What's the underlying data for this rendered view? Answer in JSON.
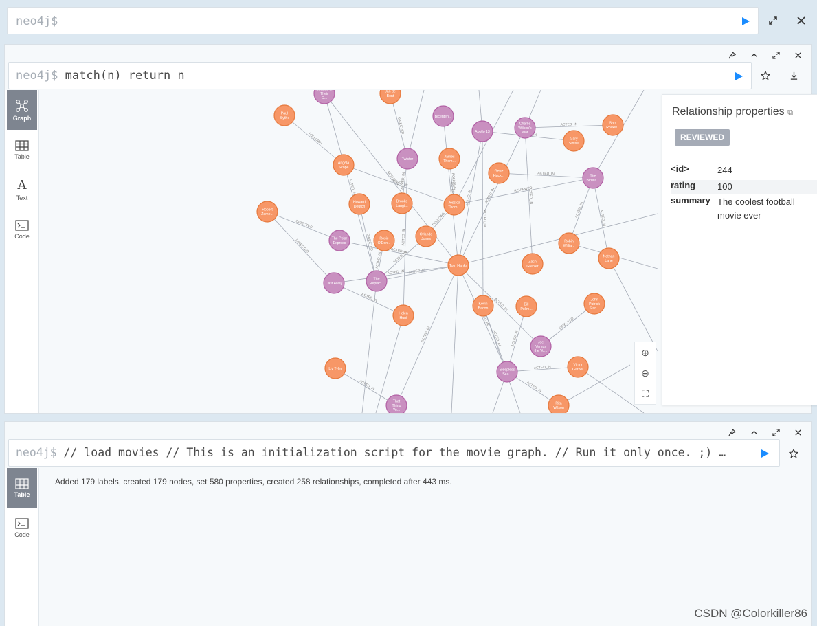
{
  "top_editor": {
    "prompt": "neo4j$"
  },
  "frame1": {
    "prompt": "neo4j$",
    "query": "match(n) return n",
    "tabs": [
      {
        "label": "Graph",
        "icon": "graph-icon"
      },
      {
        "label": "Table",
        "icon": "table-icon"
      },
      {
        "label": "Text",
        "icon": "text-icon"
      },
      {
        "label": "Code",
        "icon": "code-icon"
      }
    ],
    "panel": {
      "title": "Relationship properties",
      "badge": "REVIEWED",
      "rows": [
        {
          "key": "<id>",
          "value": "244"
        },
        {
          "key": "rating",
          "value": "100"
        },
        {
          "key": "summary",
          "value": "The coolest football movie ever"
        }
      ]
    }
  },
  "graph": {
    "colors": {
      "person": "#f79767",
      "person_stroke": "#e6793d",
      "movie": "#c990c0",
      "movie_stroke": "#b261a5",
      "edge": "#a5abb6"
    },
    "nodes": [
      {
        "id": "lt",
        "label": "League of Their O...",
        "kind": "movie"
      },
      {
        "id": "jb",
        "label": "Jan de Bont",
        "kind": "person"
      },
      {
        "id": "ps",
        "label": "Paul Blythe",
        "kind": "person"
      },
      {
        "id": "bc",
        "label": "Bicenten...",
        "kind": "movie"
      },
      {
        "id": "ap",
        "label": "Apollo 13",
        "kind": "movie"
      },
      {
        "id": "cw",
        "label": "Charlie Wilson's War",
        "kind": "movie"
      },
      {
        "id": "sr",
        "label": "Sam Rockw...",
        "kind": "person"
      },
      {
        "id": "gs",
        "label": "Gary Sinise",
        "kind": "person"
      },
      {
        "id": "as",
        "label": "Angela Scope",
        "kind": "person"
      },
      {
        "id": "tw",
        "label": "Twister",
        "kind": "movie"
      },
      {
        "id": "jt",
        "label": "James Thom...",
        "kind": "person"
      },
      {
        "id": "gh",
        "label": "Gene Hack...",
        "kind": "person"
      },
      {
        "id": "tb",
        "label": "The Birdca...",
        "kind": "movie"
      },
      {
        "id": "hd",
        "label": "Howard Deutch",
        "kind": "person"
      },
      {
        "id": "bl",
        "label": "Brooke Langt...",
        "kind": "person"
      },
      {
        "id": "jh",
        "label": "Jessica Thom...",
        "kind": "person"
      },
      {
        "id": "rz",
        "label": "Robert Zeme...",
        "kind": "person"
      },
      {
        "id": "pe",
        "label": "The Polar Express",
        "kind": "movie"
      },
      {
        "id": "ro",
        "label": "Rosie O'Don...",
        "kind": "person"
      },
      {
        "id": "oj",
        "label": "Orlando Jones",
        "kind": "person"
      },
      {
        "id": "rw",
        "label": "Robin Willia...",
        "kind": "person"
      },
      {
        "id": "nl",
        "label": "Nathan Lane",
        "kind": "person"
      },
      {
        "id": "th",
        "label": "Tom Hanks",
        "kind": "person"
      },
      {
        "id": "zg",
        "label": "Zach Grenier",
        "kind": "person"
      },
      {
        "id": "ca",
        "label": "Cast Away",
        "kind": "movie"
      },
      {
        "id": "tr",
        "label": "The Replac...",
        "kind": "movie"
      },
      {
        "id": "kb",
        "label": "Kevin Bacon",
        "kind": "person"
      },
      {
        "id": "bp",
        "label": "Bill Pullm...",
        "kind": "person"
      },
      {
        "id": "jp",
        "label": "John Patrick Stan...",
        "kind": "person"
      },
      {
        "id": "hh",
        "label": "Helen Hunt",
        "kind": "person"
      },
      {
        "id": "jv",
        "label": "Joe Versus the Vo...",
        "kind": "movie"
      },
      {
        "id": "ly",
        "label": "Liv Tyler",
        "kind": "person"
      },
      {
        "id": "vg",
        "label": "Victor Garber",
        "kind": "person"
      },
      {
        "id": "ss",
        "label": "Sleepless Sea...",
        "kind": "movie"
      },
      {
        "id": "tt",
        "label": "That Thing Yo...",
        "kind": "movie"
      },
      {
        "id": "rwl",
        "label": "Rita Wilson",
        "kind": "person"
      }
    ],
    "edges": [
      {
        "from": "ps",
        "to": "as",
        "label": "FOLLOWS"
      },
      {
        "from": "as",
        "to": "jh",
        "label": "ACTED_IN"
      },
      {
        "from": "jb",
        "to": "tw",
        "label": "DIRECTED"
      },
      {
        "from": "bl",
        "to": "tw",
        "label": "ACTED_IN"
      },
      {
        "from": "jt",
        "to": "jh",
        "label": "FOLLOWS"
      },
      {
        "from": "gh",
        "to": "tb",
        "label": "ACTED_IN"
      },
      {
        "from": "jh",
        "to": "tb",
        "label": "REVIEWED"
      },
      {
        "from": "rz",
        "to": "pe",
        "label": "DIRECTED"
      },
      {
        "from": "rz",
        "to": "ca",
        "label": "DIRECTED"
      },
      {
        "from": "hd",
        "to": "tr",
        "label": "DIRECTED"
      },
      {
        "from": "ro",
        "to": "tr",
        "label": "ACTED_IN"
      },
      {
        "from": "th",
        "to": "tr",
        "label": "ACTED_IN"
      },
      {
        "from": "th",
        "to": "ap",
        "label": "ACTED_IN"
      },
      {
        "from": "th",
        "to": "cw",
        "label": "ACTED_IN"
      },
      {
        "from": "th",
        "to": "pe",
        "label": "ACTED_IN"
      },
      {
        "from": "th",
        "to": "ca",
        "label": "ACTED_IN"
      },
      {
        "from": "th",
        "to": "jv",
        "label": "ACTED_IN"
      },
      {
        "from": "th",
        "to": "ss",
        "label": "ACTED_IN"
      },
      {
        "from": "th",
        "to": "tt",
        "label": "ACTED_IN"
      },
      {
        "from": "gs",
        "to": "ap",
        "label": "ACTED_IN"
      },
      {
        "from": "kb",
        "to": "ap",
        "label": "ACTED_IN"
      },
      {
        "from": "hh",
        "to": "ca",
        "label": "ACTED_IN"
      },
      {
        "from": "ly",
        "to": "tt",
        "label": "ACTED_IN"
      },
      {
        "from": "vg",
        "to": "ss",
        "label": "ACTED_IN"
      },
      {
        "from": "bp",
        "to": "ss",
        "label": "ACTED_IN"
      },
      {
        "from": "rwl",
        "to": "ss",
        "label": "ACTED_IN"
      },
      {
        "from": "jp",
        "to": "jv",
        "label": "DIRECTED"
      },
      {
        "from": "rw",
        "to": "tb",
        "label": "ACTED_IN"
      },
      {
        "from": "nl",
        "to": "tb",
        "label": "ACTED_IN"
      },
      {
        "from": "sr",
        "to": "cw",
        "label": "ACTED_IN"
      },
      {
        "from": "zg",
        "to": "cw",
        "label": "ACTED_IN"
      },
      {
        "from": "oj",
        "to": "tr",
        "label": "ACTED_IN"
      },
      {
        "from": "hh",
        "to": "tw",
        "label": "ACTED_IN"
      },
      {
        "from": "bc",
        "to": "th",
        "label": "ACTED_IN"
      },
      {
        "from": "lt",
        "to": "tr",
        "label": "ACTED_IN"
      },
      {
        "from": "kb",
        "to": "ss",
        "label": "ACTED_IN"
      },
      {
        "from": "th",
        "to": "lt",
        "label": "ACTED_IN"
      },
      {
        "from": "oj",
        "to": "jh",
        "label": "FOLLOWS"
      }
    ]
  },
  "frame2": {
    "prompt": "neo4j$",
    "query": "// load movies // This is an initialization script for the movie graph. // Run it only once. ;) …",
    "tabs": [
      {
        "label": "Table",
        "icon": "table-icon"
      },
      {
        "label": "Code",
        "icon": "code-icon"
      }
    ],
    "result": "Added 179 labels, created 179 nodes, set 580 properties, created 258 relationships, completed after 443 ms."
  },
  "watermark": "CSDN @Colorkiller86"
}
